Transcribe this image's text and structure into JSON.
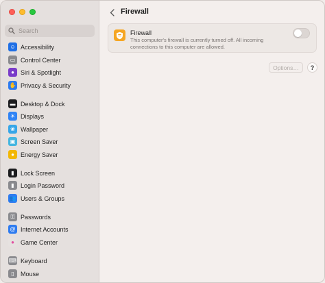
{
  "search": {
    "placeholder": "Search"
  },
  "sidebar": {
    "items": [
      {
        "label": "Accessibility",
        "icon": "accessibility-icon",
        "color": "#1f6fe5",
        "glyph": "☺"
      },
      {
        "label": "Control Center",
        "icon": "control-center-icon",
        "color": "#8a8a8e",
        "glyph": "▭"
      },
      {
        "label": "Siri & Spotlight",
        "icon": "siri-icon",
        "color": "#7a3cc9",
        "glyph": "●"
      },
      {
        "label": "Privacy & Security",
        "icon": "hand-icon",
        "color": "#2d7bf0",
        "glyph": "✋"
      },
      {
        "label": "Desktop & Dock",
        "icon": "desktop-dock-icon",
        "color": "#1c1c1e",
        "glyph": "▬"
      },
      {
        "label": "Displays",
        "icon": "displays-icon",
        "color": "#2f83f5",
        "glyph": "☀"
      },
      {
        "label": "Wallpaper",
        "icon": "wallpaper-icon",
        "color": "#37a6e8",
        "glyph": "❀"
      },
      {
        "label": "Screen Saver",
        "icon": "screen-saver-icon",
        "color": "#45b6e0",
        "glyph": "▣"
      },
      {
        "label": "Energy Saver",
        "icon": "energy-saver-icon",
        "color": "#f2b705",
        "glyph": "●"
      },
      {
        "label": "Lock Screen",
        "icon": "lock-screen-icon",
        "color": "#1c1c1e",
        "glyph": "▮"
      },
      {
        "label": "Login Password",
        "icon": "login-password-icon",
        "color": "#8a8a8e",
        "glyph": "▮"
      },
      {
        "label": "Users & Groups",
        "icon": "users-groups-icon",
        "color": "#2f7cf0",
        "glyph": "👥"
      },
      {
        "label": "Passwords",
        "icon": "key-icon",
        "color": "#8a8a8e",
        "glyph": "⚿"
      },
      {
        "label": "Internet Accounts",
        "icon": "at-sign-icon",
        "color": "#2f7cf0",
        "glyph": "@"
      },
      {
        "label": "Game Center",
        "icon": "game-center-icon",
        "color": "#e6e2e0",
        "glyph": "●"
      },
      {
        "label": "Keyboard",
        "icon": "keyboard-icon",
        "color": "#8a8a8e",
        "glyph": "⌨"
      },
      {
        "label": "Mouse",
        "icon": "mouse-icon",
        "color": "#8a8a8e",
        "glyph": "▯"
      }
    ]
  },
  "header": {
    "title": "Firewall"
  },
  "firewall": {
    "title": "Firewall",
    "description": "This computer's firewall is currently turned off. All incoming connections to this computer are allowed.",
    "enabled": false,
    "icon": "firewall-shield-icon",
    "icon_color": "#f5a623"
  },
  "buttons": {
    "options": "Options…",
    "help": "?"
  }
}
